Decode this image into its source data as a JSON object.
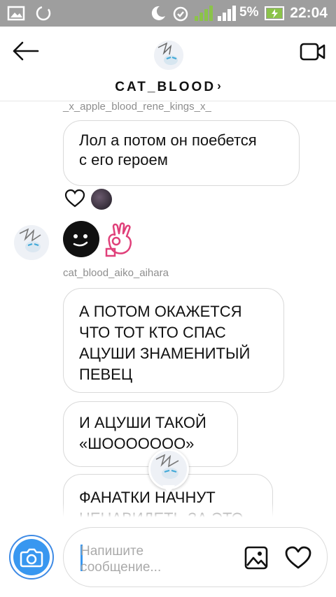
{
  "status_bar": {
    "battery_percent": "5%",
    "time": "22:04",
    "sim_label": "2"
  },
  "header": {
    "username": "CAT_BLOOD",
    "chevron": "›"
  },
  "messages": [
    {
      "sender": "_x_apple_blood_rene_kings_x_",
      "text": "Лол а потом он поебется\nс его героем"
    },
    {
      "sender": "cat_blood_aiko_aihara",
      "text": "А ПОТОМ ОКАЖЕТСЯ\nЧТО ТОТ КТО СПАС\nАЦУШИ ЗНАМЕНИТЫЙ\nПЕВЕЦ"
    },
    {
      "text": "И АЦУШИ ТАКОЙ\n«ШООООООО»"
    },
    {
      "text": "ФАНАТКИ НАЧНУТ\nНЕНАВИДЕТЬ ЗА ЭТО"
    }
  ],
  "composer": {
    "placeholder": "Напишите\nсообщение..."
  },
  "icons": {
    "back": "back-arrow-icon",
    "video": "video-call-icon",
    "camera": "camera-icon",
    "gallery": "gallery-icon",
    "like": "heart-icon"
  },
  "colors": {
    "accent": "#3897f0",
    "status_bar": "#9e9e9e",
    "signal_green": "#8bc34a"
  }
}
